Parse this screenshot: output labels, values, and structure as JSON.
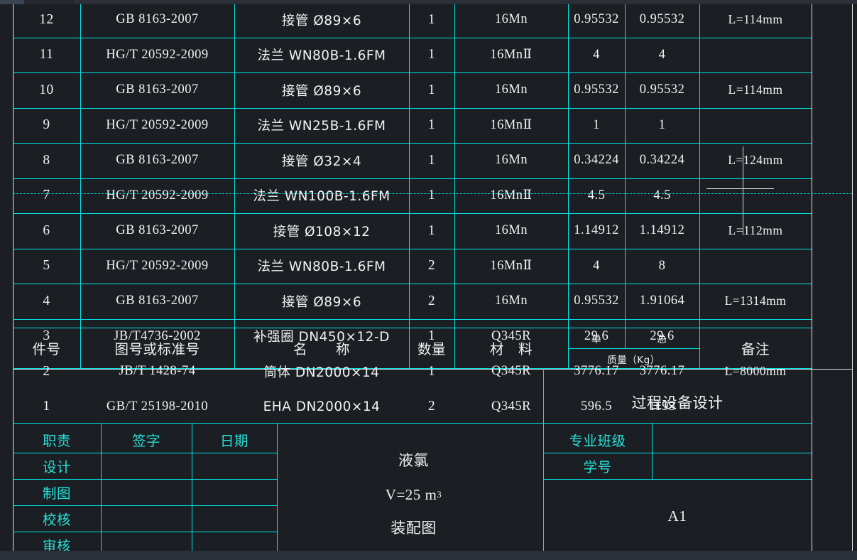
{
  "app": {
    "kind": "cad-drawing-title-block",
    "colors": {
      "background": "#1b1e23",
      "grid_cyan": "#00e5e5",
      "text_white": "#f2f2f2",
      "text_cyan": "#28e0d8",
      "cursor": "#dcdcdc"
    }
  },
  "parts_table": {
    "columns": [
      {
        "key": "item_no",
        "label": "件号"
      },
      {
        "key": "drawing_no",
        "label": "图号或标准号"
      },
      {
        "key": "name",
        "label": "名　　称"
      },
      {
        "key": "qty",
        "label": "数量"
      },
      {
        "key": "material",
        "label": "材　料"
      },
      {
        "key": "mass_unit",
        "label": "单"
      },
      {
        "key": "mass_total",
        "label": "总"
      },
      {
        "key": "remark",
        "label": "备注"
      }
    ],
    "mass_group_label": "质量（Kg）",
    "rows": [
      {
        "item_no": "12",
        "drawing_no": "GB 8163-2007",
        "name": "接管 Ø89×6",
        "qty": "1",
        "material": "16Mn",
        "mass_unit": "0.95532",
        "mass_total": "0.95532",
        "remark": "L=114mm"
      },
      {
        "item_no": "11",
        "drawing_no": "HG/T 20592-2009",
        "name": "法兰 WN80B-1.6FM",
        "qty": "1",
        "material": "16MnⅡ",
        "mass_unit": "4",
        "mass_total": "4",
        "remark": ""
      },
      {
        "item_no": "10",
        "drawing_no": "GB 8163-2007",
        "name": "接管 Ø89×6",
        "qty": "1",
        "material": "16Mn",
        "mass_unit": "0.95532",
        "mass_total": "0.95532",
        "remark": "L=114mm"
      },
      {
        "item_no": "9",
        "drawing_no": "HG/T 20592-2009",
        "name": "法兰 WN25B-1.6FM",
        "qty": "1",
        "material": "16MnⅡ",
        "mass_unit": "1",
        "mass_total": "1",
        "remark": ""
      },
      {
        "item_no": "8",
        "drawing_no": "GB 8163-2007",
        "name": "接管 Ø32×4",
        "qty": "1",
        "material": "16Mn",
        "mass_unit": "0.34224",
        "mass_total": "0.34224",
        "remark": "L=124mm"
      },
      {
        "item_no": "7",
        "drawing_no": "HG/T 20592-2009",
        "name": "法兰 WN100B-1.6FM",
        "qty": "1",
        "material": "16MnⅡ",
        "mass_unit": "4.5",
        "mass_total": "4.5",
        "remark": ""
      },
      {
        "item_no": "6",
        "drawing_no": "GB 8163-2007",
        "name": "接管 Ø108×12",
        "qty": "1",
        "material": "16Mn",
        "mass_unit": "1.14912",
        "mass_total": "1.14912",
        "remark": "L=112mm"
      },
      {
        "item_no": "5",
        "drawing_no": "HG/T 20592-2009",
        "name": "法兰 WN80B-1.6FM",
        "qty": "2",
        "material": "16MnⅡ",
        "mass_unit": "4",
        "mass_total": "8",
        "remark": ""
      },
      {
        "item_no": "4",
        "drawing_no": "GB 8163-2007",
        "name": "接管 Ø89×6",
        "qty": "2",
        "material": "16Mn",
        "mass_unit": "0.95532",
        "mass_total": "1.91064",
        "remark": "L=1314mm"
      },
      {
        "item_no": "3",
        "drawing_no": "JB/T4736-2002",
        "name": "补强圈 DN450×12-D",
        "qty": "1",
        "material": "Q345R",
        "mass_unit": "29.6",
        "mass_total": "29.6",
        "remark": ""
      },
      {
        "item_no": "2",
        "drawing_no": "JB/T 1428-74",
        "name": "筒体 DN2000×14",
        "qty": "1",
        "material": "Q345R",
        "mass_unit": "3776.17",
        "mass_total": "3776.17",
        "remark": "L=8000mm"
      },
      {
        "item_no": "1",
        "drawing_no": "GB/T 25198-2010",
        "name": "EHA DN2000×14",
        "qty": "2",
        "material": "Q345R",
        "mass_unit": "596.5",
        "mass_total": "1193",
        "remark": ""
      }
    ]
  },
  "title_block": {
    "signature_table": {
      "headers": {
        "role": "职责",
        "signature": "签字",
        "date": "日期"
      },
      "rows": [
        {
          "role": "设计",
          "signature": "",
          "date": ""
        },
        {
          "role": "制图",
          "signature": "",
          "date": ""
        },
        {
          "role": "校核",
          "signature": "",
          "date": ""
        },
        {
          "role": "审核",
          "signature": "",
          "date": ""
        }
      ]
    },
    "center": {
      "line1": "液氯",
      "line2_prefix": "V=25 m",
      "line2_exponent": "3",
      "line3": "装配图"
    },
    "right": {
      "course_title": "过程设备设计",
      "class_label": "专业班级",
      "class_value": "",
      "student_id_label": "学号",
      "student_id_value": "",
      "sheet_size": "A1"
    }
  }
}
